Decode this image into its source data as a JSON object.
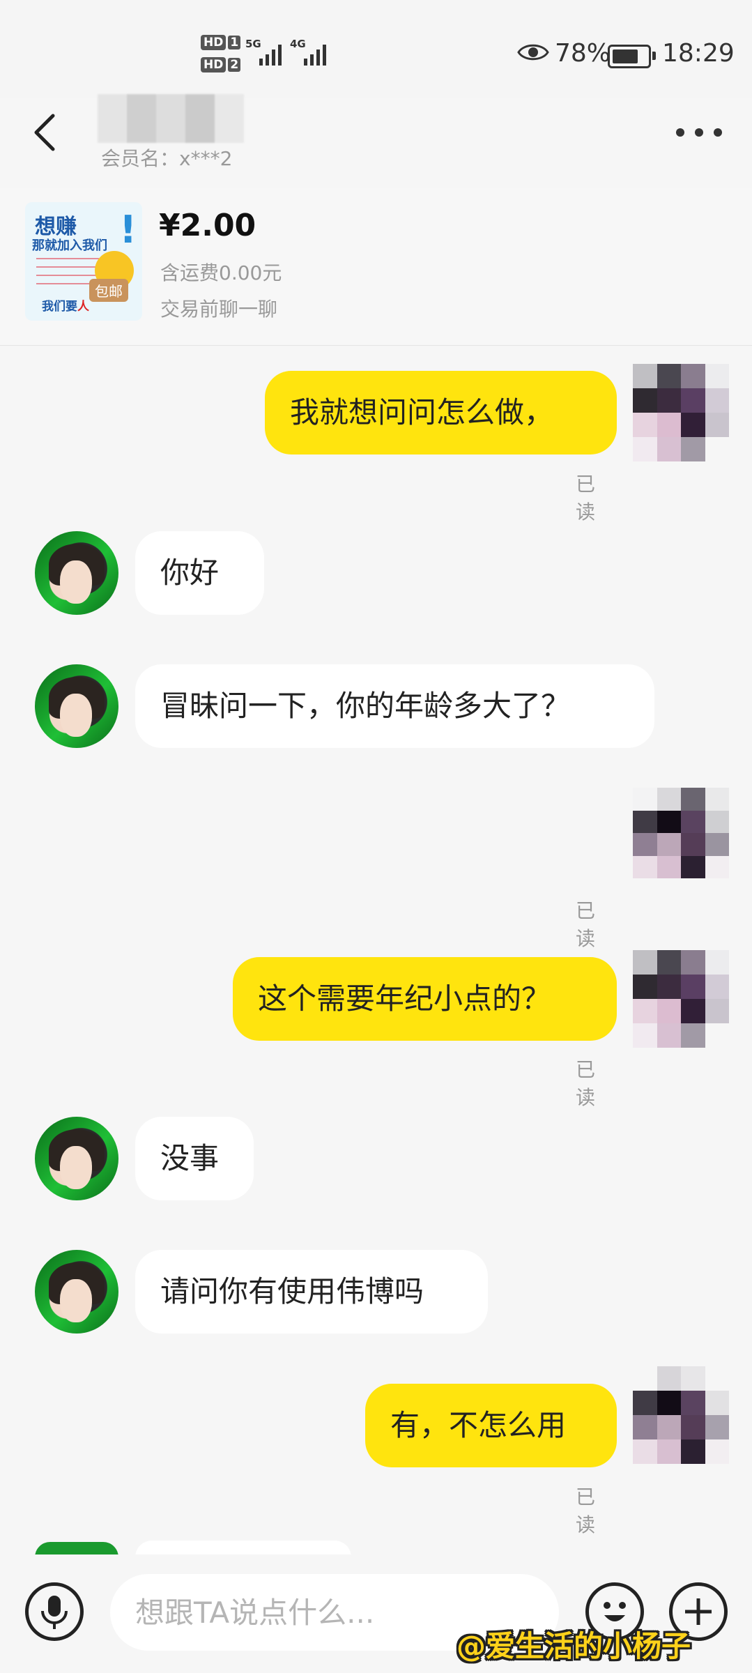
{
  "status_bar": {
    "sim1_label": "HD",
    "sim1_index": "1",
    "sim2_label": "HD",
    "sim2_index": "2",
    "net1": "5G",
    "net2": "4G",
    "battery_pct": "78%",
    "time": "18:29"
  },
  "header": {
    "member_label": "会员名：x***2"
  },
  "product": {
    "image_text_1": "想赚",
    "image_text_2": "那就加入我们",
    "image_text_3a": "我们要",
    "image_text_3b": "人",
    "image_badge": "包邮",
    "price": "¥2.00",
    "shipping": "含运费0.00元",
    "prompt": "交易前聊一聊"
  },
  "messages": [
    {
      "from": "me",
      "text": "我就想问问怎么做，",
      "status": "已读"
    },
    {
      "from": "them",
      "text": "你好"
    },
    {
      "from": "them",
      "text": "冒昧问一下，你的年龄多大了？"
    },
    {
      "from": "me",
      "text": "",
      "status": "已读"
    },
    {
      "from": "me",
      "text": "这个需要年纪小点的？",
      "status": "已读"
    },
    {
      "from": "them",
      "text": "没事"
    },
    {
      "from": "them",
      "text": "请问你有使用伟博吗"
    },
    {
      "from": "me",
      "text": "有，不怎么用",
      "status": "已读"
    }
  ],
  "input": {
    "placeholder": "想跟TA说点什么..."
  },
  "watermark": "@爱生活的小杨子",
  "colors": {
    "my_bubble": "#ffe40e",
    "their_bubble": "#ffffff",
    "background": "#f6f6f6"
  }
}
